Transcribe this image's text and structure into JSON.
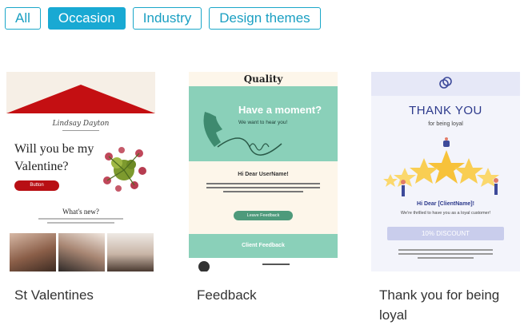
{
  "filters": [
    {
      "label": "All",
      "active": false
    },
    {
      "label": "Occasion",
      "active": true
    },
    {
      "label": "Industry",
      "active": false
    },
    {
      "label": "Design themes",
      "active": false
    }
  ],
  "colors": {
    "accent": "#19a9d3",
    "valentine_red": "#b80f14",
    "mint": "#8ad0b9",
    "navy": "#2d3a8c"
  },
  "cards": [
    {
      "title": "St Valentines",
      "preview": {
        "signature": "Lindsay Dayton",
        "headline_1": "Will you be my",
        "headline_2": "Valentine?",
        "button": "Button",
        "section": "What's new?",
        "icon": "rose-bouquet-icon"
      }
    },
    {
      "title": "Feedback",
      "preview": {
        "logo": "Quality",
        "hero_title": "Have a moment?",
        "hero_subtitle": "We want to hear you!",
        "greeting": "Hi Dear UserName!",
        "button": "Leave Feedback",
        "band": "Client Feedback",
        "icon": "telephone-icon"
      }
    },
    {
      "title": "Thank you for being loyal",
      "preview": {
        "title": "THANK YOU",
        "subtitle": "for being loyal",
        "greeting": "Hi Dear [ClientName]!",
        "line": "We're thrilled to have you as a loyal customer!",
        "discount": "10% DISCOUNT",
        "icon": "stars-trophy-icon"
      }
    }
  ]
}
